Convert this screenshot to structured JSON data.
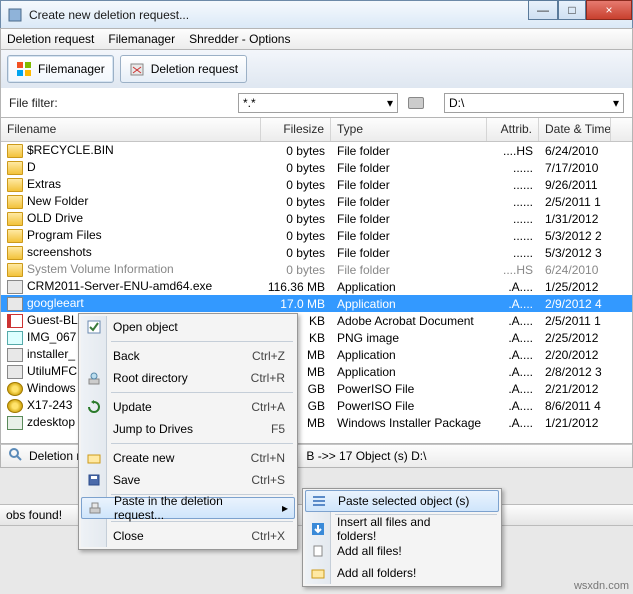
{
  "window": {
    "title": "Create new deletion request...",
    "min": "—",
    "max": "□",
    "close": "×"
  },
  "menu": {
    "deletion": "Deletion request",
    "filemanager": "Filemanager",
    "shredder": "Shredder - Options"
  },
  "tabs": {
    "fm": "Filemanager",
    "dr": "Deletion request"
  },
  "filter": {
    "label": "File filter:",
    "pattern": "*.*",
    "drive": "D:\\"
  },
  "columns": {
    "name": "Filename",
    "size": "Filesize",
    "type": "Type",
    "attr": "Attrib.",
    "date": "Date & Time"
  },
  "rows": [
    {
      "icon": "folder-icon",
      "name": "$RECYCLE.BIN",
      "size": "0 bytes",
      "type": "File folder",
      "attr": "....HS",
      "date": "6/24/2010"
    },
    {
      "icon": "folder-icon",
      "name": "D",
      "size": "0 bytes",
      "type": "File folder",
      "attr": "......",
      "date": "7/17/2010"
    },
    {
      "icon": "folder-icon",
      "name": "Extras",
      "size": "0 bytes",
      "type": "File folder",
      "attr": "......",
      "date": "9/26/2011"
    },
    {
      "icon": "folder-icon",
      "name": "New Folder",
      "size": "0 bytes",
      "type": "File folder",
      "attr": "......",
      "date": "2/5/2011 1"
    },
    {
      "icon": "folder-icon",
      "name": "OLD Drive",
      "size": "0 bytes",
      "type": "File folder",
      "attr": "......",
      "date": "1/31/2012"
    },
    {
      "icon": "folder-icon",
      "name": "Program Files",
      "size": "0 bytes",
      "type": "File folder",
      "attr": "......",
      "date": "5/3/2012 2"
    },
    {
      "icon": "folder-icon",
      "name": "screenshots",
      "size": "0 bytes",
      "type": "File folder",
      "attr": "......",
      "date": "5/3/2012 3"
    },
    {
      "icon": "folder-icon",
      "name": "System Volume Information",
      "size": "0 bytes",
      "type": "File folder",
      "attr": "....HS",
      "date": "6/24/2010",
      "dim": true
    },
    {
      "icon": "app-icon",
      "name": "CRM2011-Server-ENU-amd64.exe",
      "size": "116.36 MB",
      "type": "Application",
      "attr": ".A....",
      "date": "1/25/2012"
    },
    {
      "icon": "app-icon",
      "name": "googleeart",
      "size": "17.0 MB",
      "type": "Application",
      "attr": ".A....",
      "date": "2/9/2012 4",
      "sel": true
    },
    {
      "icon": "pdf-icon",
      "name": "Guest-BL",
      "size": " KB",
      "type": "Adobe Acrobat Document",
      "attr": ".A....",
      "date": "2/5/2011 1"
    },
    {
      "icon": "png-icon",
      "name": "IMG_067",
      "size": " KB",
      "type": "PNG image",
      "attr": ".A....",
      "date": "2/25/2012"
    },
    {
      "icon": "app-icon",
      "name": "installer_",
      "size": " MB",
      "type": "Application",
      "attr": ".A....",
      "date": "2/20/2012"
    },
    {
      "icon": "app-icon",
      "name": "UtiluMFC",
      "size": " MB",
      "type": "Application",
      "attr": ".A....",
      "date": "2/8/2012 3"
    },
    {
      "icon": "iso-icon",
      "name": "Windows",
      "size": " GB",
      "type": "PowerISO File",
      "attr": ".A....",
      "date": "2/21/2012"
    },
    {
      "icon": "iso-icon",
      "name": "X17-243",
      "size": " GB",
      "type": "PowerISO File",
      "attr": ".A....",
      "date": "8/6/2011 4"
    },
    {
      "icon": "msi-icon",
      "name": "zdesktop",
      "size": " MB",
      "type": "Windows Installer Package",
      "attr": ".A....",
      "date": "1/21/2012"
    }
  ],
  "status": {
    "prefix": "Deletion r",
    "text": "B  ->>  17   Object (s)   D:\\"
  },
  "jobbar": "obs found!",
  "ctx1": {
    "open": "Open object",
    "back": "Back",
    "back_sc": "Ctrl+Z",
    "root": "Root directory",
    "root_sc": "Ctrl+R",
    "update": "Update",
    "update_sc": "Ctrl+A",
    "jump": "Jump to Drives",
    "jump_sc": "F5",
    "create": "Create new",
    "create_sc": "Ctrl+N",
    "save": "Save",
    "save_sc": "Ctrl+S",
    "paste": "Paste in the deletion request...",
    "close": "Close",
    "close_sc": "Ctrl+X"
  },
  "ctx2": {
    "paste_sel": "Paste selected object (s)",
    "insert_all": "Insert all files and folders!",
    "add_files": "Add all files!",
    "add_folders": "Add all folders!"
  },
  "watermark": "wsxdn.com"
}
